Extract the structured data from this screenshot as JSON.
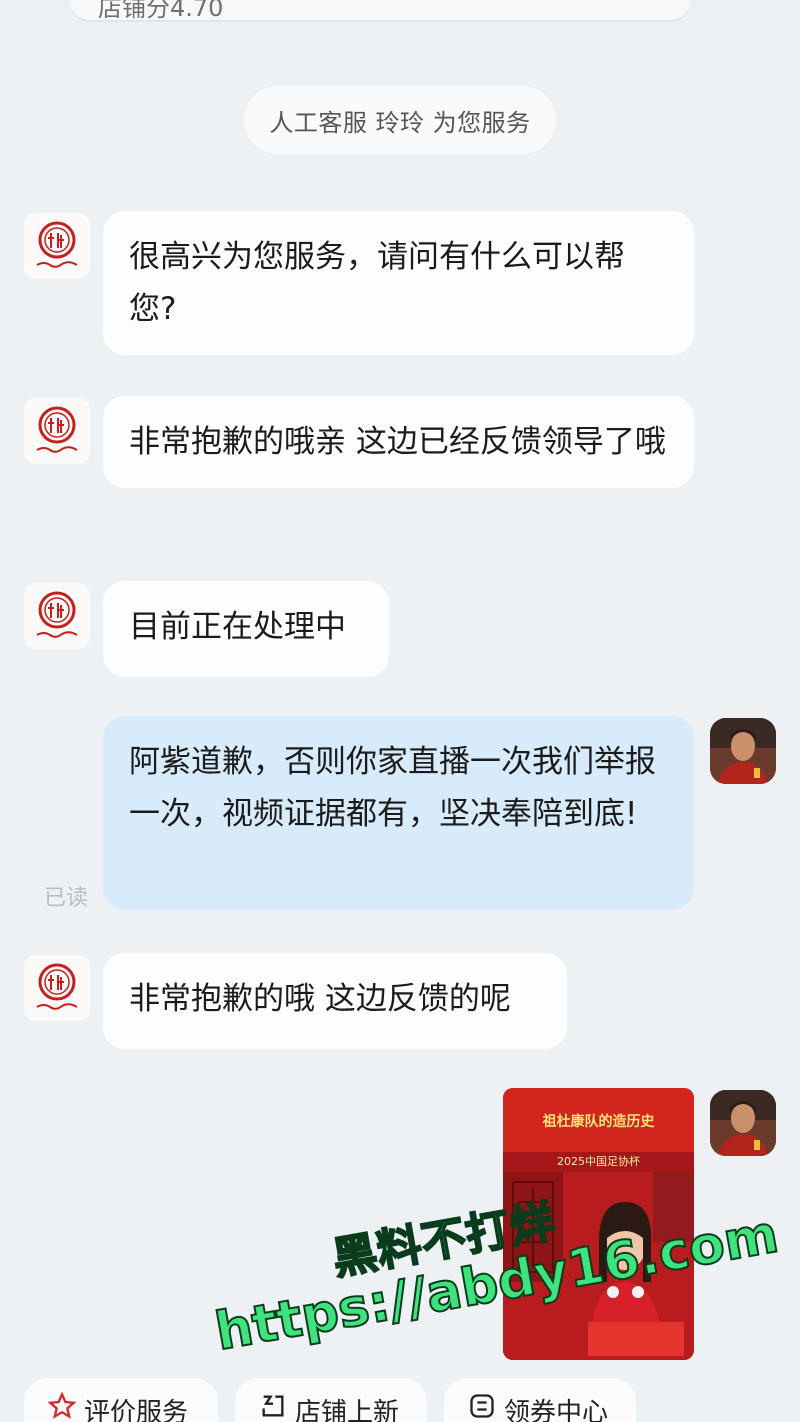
{
  "store": {
    "score_text": "店铺分4.70"
  },
  "service_notice": "人工客服 玲玲 为您服务",
  "messages": [
    {
      "from": "store",
      "text": "很高兴为您服务，请问有什么可以帮您?"
    },
    {
      "from": "store",
      "text": "非常抱歉的哦亲  这边已经反馈领导了哦"
    },
    {
      "from": "store",
      "text": "目前正在处理中"
    },
    {
      "from": "user",
      "text": "阿紫道歉，否则你家直播一次我们举报一次，视频证据都有，坚决奉陪到底!"
    },
    {
      "from": "store",
      "text": "非常抱歉的哦 这边反馈的呢"
    }
  ],
  "read_status": "已读",
  "image_message": {
    "banner_text": "祖杜康队的造历史",
    "year_text": "2025中国足协杯"
  },
  "watermark": {
    "line1": "黑料不打烊",
    "line2": "https://abdy16.com"
  },
  "actions": [
    {
      "label": "评价服务",
      "icon": "star-icon"
    },
    {
      "label": "店铺上新",
      "icon": "new-icon"
    },
    {
      "label": "领券中心",
      "icon": "coupon-icon"
    }
  ],
  "colors": {
    "background": "#eef1f3",
    "user_bubble": "#d7ebfb",
    "store_bubble": "#fdfdfd",
    "brand_red": "#c4201c",
    "watermark_green": "#3fe37e"
  }
}
